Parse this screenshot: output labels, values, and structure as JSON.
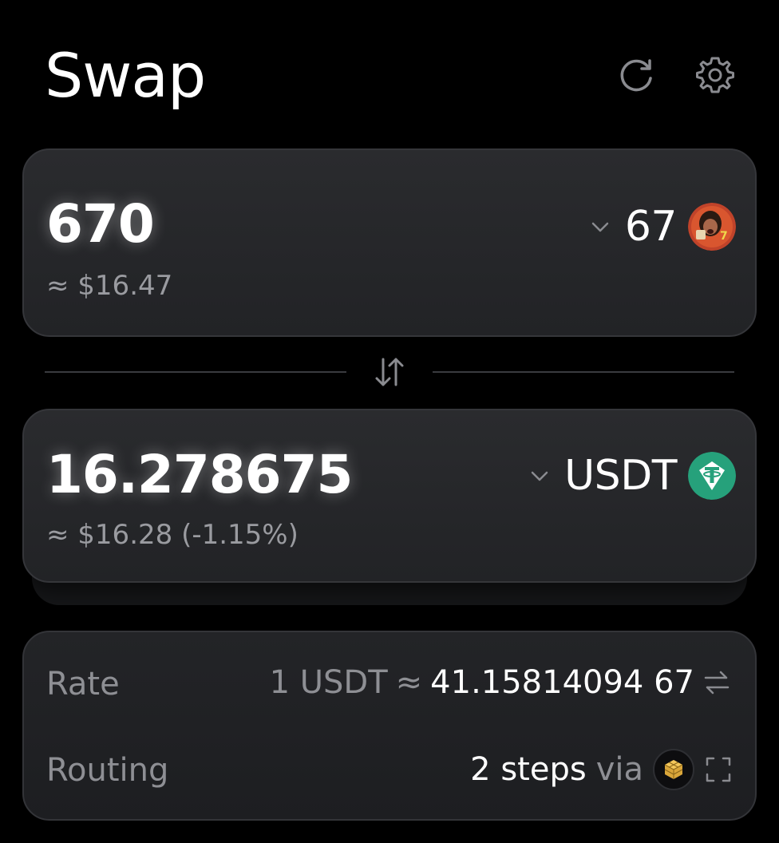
{
  "header": {
    "title": "Swap"
  },
  "from": {
    "amount": "670",
    "usd_value": "≈ $16.47",
    "token": "67"
  },
  "to": {
    "amount": "16.278675",
    "usd_value": "≈ $16.28 (-1.15%)",
    "token": "USDT"
  },
  "info": {
    "rate_label": "Rate",
    "rate_left": "1 USDT",
    "rate_approx": "≈",
    "rate_right": "41.15814094 67",
    "routing_label": "Routing",
    "routing_steps": "2 steps",
    "routing_via": "via"
  },
  "colors": {
    "background": "#000000",
    "card": "#26272a",
    "muted_text": "#8e8f94",
    "usdt": "#26a17b"
  },
  "icons": [
    "refresh-icon",
    "gear-icon",
    "chevron-down-icon",
    "swap-direction-icon",
    "token-67-logo",
    "usdt-logo",
    "swap-rate-icon",
    "hive-logo",
    "expand-icon"
  ]
}
